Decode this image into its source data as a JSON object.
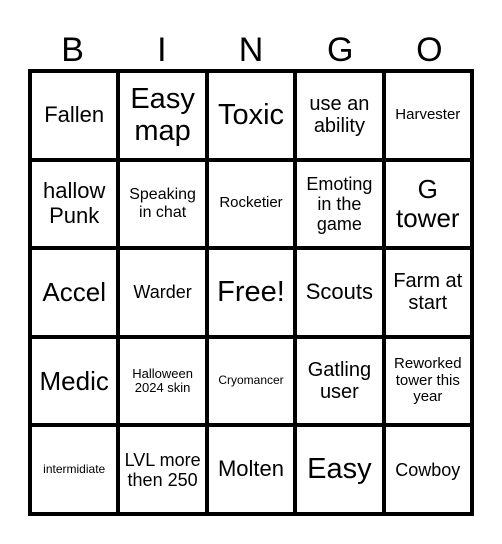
{
  "header": {
    "letters": [
      "B",
      "I",
      "N",
      "G",
      "O"
    ]
  },
  "cells": [
    "Fallen",
    "Easy map",
    "Toxic",
    "use an ability",
    "Harvester",
    "hallow Punk",
    "Speaking in chat",
    "Rocketier",
    "Emoting in the game",
    "G tower",
    "Accel",
    "Warder",
    "Free!",
    "Scouts",
    "Farm at start",
    "Medic",
    "Halloween 2024 skin",
    "Cryomancer",
    "Gatling user",
    "Reworked tower this year",
    "intermidiate",
    "LVL more then 250",
    "Molten",
    "Easy",
    "Cowboy"
  ]
}
